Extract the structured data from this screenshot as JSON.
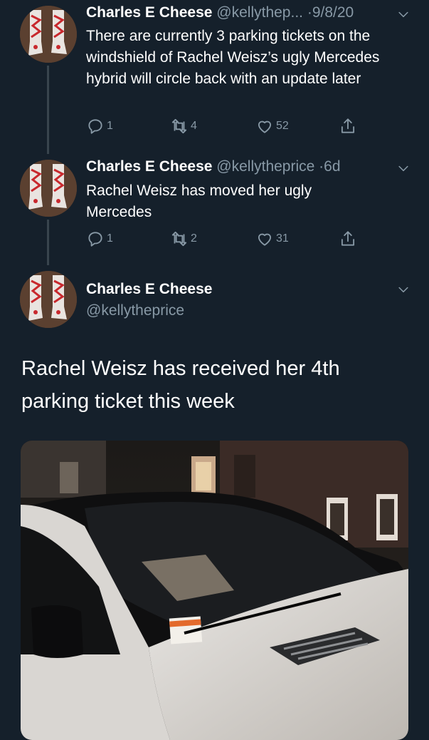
{
  "tweets": [
    {
      "name": "Charles E Cheese",
      "handle": "@kellythep...",
      "time": "·9/8/20",
      "text": "There are currently 3 parking tickets on the windshield of Rachel Weisz’s ugly Mercedes hybrid will circle back with an update later",
      "replies": "1",
      "retweets": "4",
      "likes": "52"
    },
    {
      "name": "Charles E Cheese",
      "handle": "@kellytheprice",
      "time": "·6d",
      "text": "Rachel Weisz has moved her ugly Mercedes",
      "replies": "1",
      "retweets": "2",
      "likes": "31"
    }
  ],
  "main": {
    "name": "Charles E Cheese",
    "handle": "@kellytheprice",
    "text": "Rachel Weisz has received her 4th parking ticket this week"
  },
  "icons": {
    "reply": "reply-icon",
    "retweet": "retweet-icon",
    "like": "heart-icon",
    "share": "share-icon",
    "more": "chevron-down-icon"
  },
  "colors": {
    "background": "#15202b",
    "secondary_text": "#8899a6",
    "thread_line": "#38444d"
  }
}
